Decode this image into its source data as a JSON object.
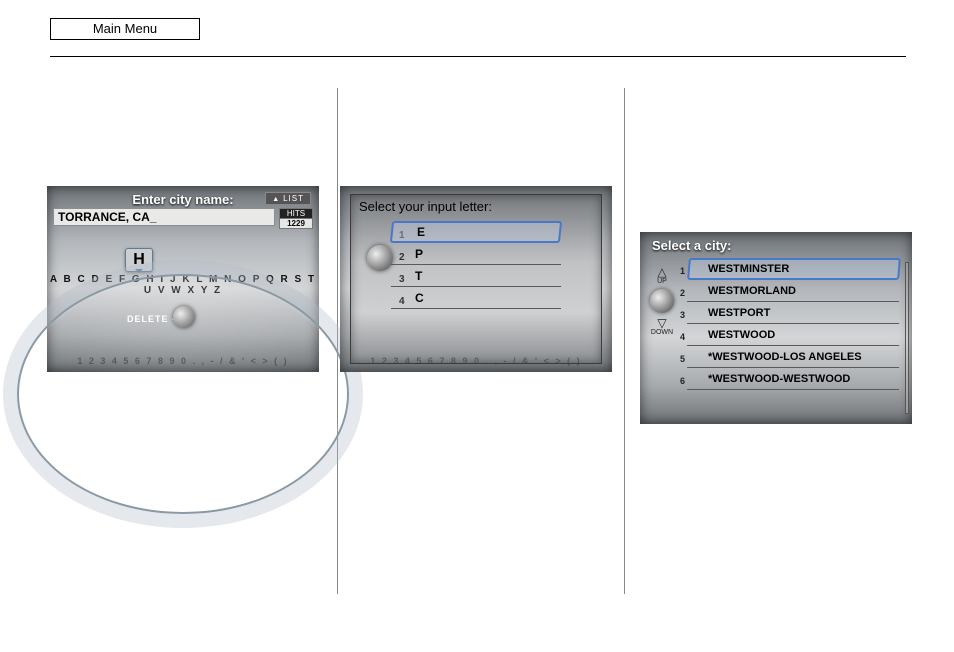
{
  "main_menu_label": "Main Menu",
  "screen1": {
    "title": "Enter city name:",
    "input_value": "TORRANCE, CA_",
    "list_label": "LIST",
    "hits_label": "HITS",
    "hits_value": "1229",
    "letters": "A B C D E F G H I J K L M N O P Q R S T U V W X Y Z",
    "numbers_row": "1 2 3 4 5 6 7 8 9 0 . , - / & ' < > ( )",
    "bubble_letter": "H",
    "delete_label": "DELETE"
  },
  "screen2": {
    "title": "Select your input letter:",
    "options": [
      "E",
      "P",
      "T",
      "C"
    ],
    "numbers_row": "1 2 3 4 5 6 7 8 9 0 . , - / & ' < > ( )"
  },
  "screen3": {
    "title": "Select a city:",
    "up_label": "UP",
    "down_label": "DOWN",
    "cities": [
      "WESTMINSTER",
      "WESTMORLAND",
      "WESTPORT",
      "WESTWOOD",
      "*WESTWOOD-LOS ANGELES",
      "*WESTWOOD-WESTWOOD"
    ]
  }
}
